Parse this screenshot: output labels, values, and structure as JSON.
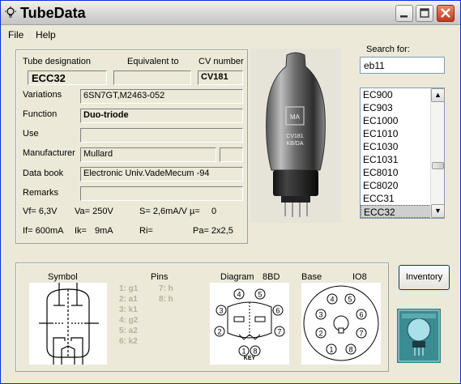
{
  "window": {
    "title": "TubeData"
  },
  "menu": {
    "file": "File",
    "help": "Help"
  },
  "details": {
    "tube_designation_label": "Tube designation",
    "tube_designation": "ECC32",
    "equivalent_label": "Equivalent to",
    "equivalent": "",
    "cv_label": "CV number",
    "cv": "CV181",
    "variations_label": "Variations",
    "variations": "6SN7GT,M2463-052",
    "function_label": "Function",
    "function": "Duo-triode",
    "use_label": "Use",
    "use": "",
    "manufacturer_label": "Manufacturer",
    "manufacturer": "Mullard",
    "manufacturer_extra": "",
    "databook_label": "Data book",
    "databook": "Electronic Univ.VadeMecum -94",
    "remarks_label": "Remarks",
    "remarks": ""
  },
  "specs": {
    "vf": "Vf= 6,3V",
    "va": "Va= 250V",
    "s": "S= 2,6mA/V",
    "mu": "µ=",
    "mu_val": "0",
    "if": "If= 600mA",
    "ik": "Ik=",
    "ik_val": "9mA",
    "ri": "Ri=",
    "pa": "Pa= 2x2,5"
  },
  "search": {
    "label": "Search for:",
    "value": "eb11",
    "items": [
      "EC900",
      "EC903",
      "EC1000",
      "EC1010",
      "EC1030",
      "EC1031",
      "EC8010",
      "EC8020",
      "ECC31",
      "ECC32"
    ],
    "selected_index": 9
  },
  "lower": {
    "symbol_label": "Symbol",
    "pins_label": "Pins",
    "diagram_label": "Diagram",
    "diagram_code": "8BD",
    "base_label": "Base",
    "base_code": "IO8",
    "pins_col1": [
      "1: g1",
      "2: a1",
      "3: k1",
      "4: g2",
      "5: a2",
      "6: k2"
    ],
    "pins_col2": [
      "7: h",
      "8: h"
    ],
    "key_label": "KEY",
    "inventory_button": "Inventory"
  },
  "diagram_pins": [
    "1",
    "2",
    "3",
    "4",
    "5",
    "6",
    "7",
    "8"
  ],
  "base_pins": [
    "1",
    "2",
    "3",
    "4",
    "5",
    "6",
    "7",
    "8"
  ],
  "tube_label": {
    "brand": "MA",
    "line1": "CV181",
    "line2": "KB/DA"
  }
}
